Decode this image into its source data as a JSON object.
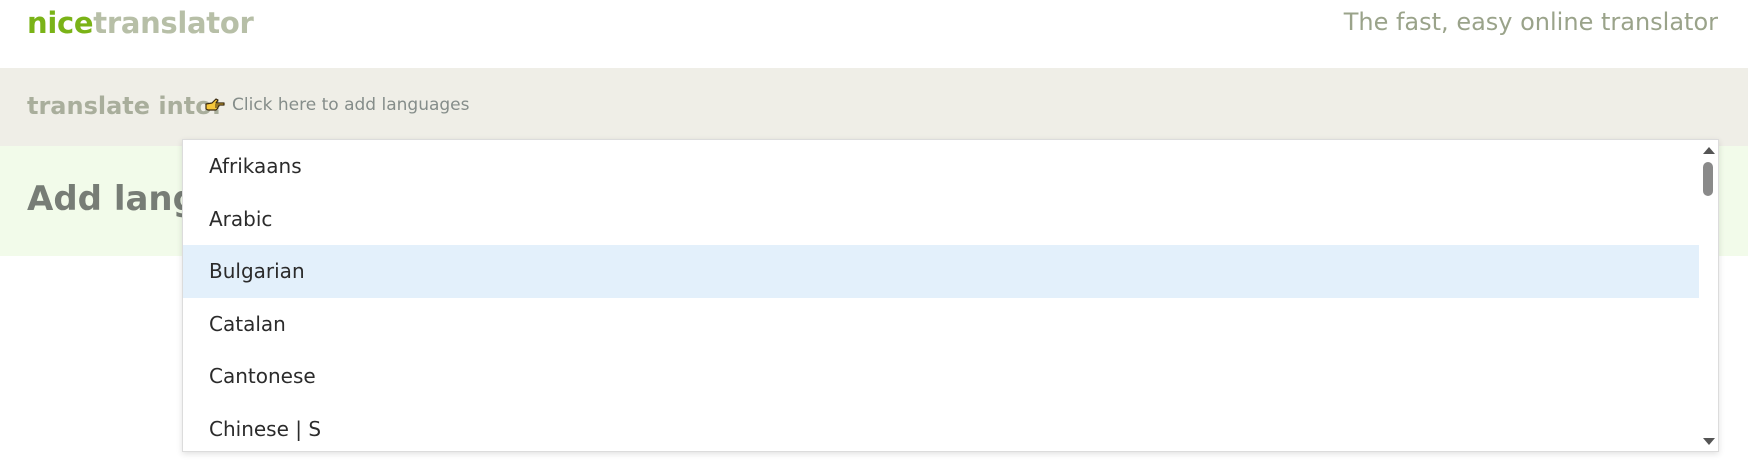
{
  "header": {
    "logo": {
      "part1": "nice",
      "part2": "translator"
    },
    "tagline": "The fast, easy online translator"
  },
  "translate_bar": {
    "label": "translate into:",
    "add_languages_link": "Click here to add languages",
    "icon": "pointing-hand-icon"
  },
  "main": {
    "heading_partial": "Add langu"
  },
  "dropdown": {
    "items": [
      {
        "label": "Afrikaans",
        "highlighted": false
      },
      {
        "label": "Arabic",
        "highlighted": false
      },
      {
        "label": "Bulgarian",
        "highlighted": true
      },
      {
        "label": "Catalan",
        "highlighted": false
      },
      {
        "label": "Cantonese",
        "highlighted": false
      },
      {
        "label": "Chinese | S",
        "highlighted": false
      }
    ]
  },
  "colors": {
    "brand_green": "#7ab317",
    "logo_gray": "#b7bfa7",
    "bar_background": "#efeee7",
    "band_background": "#f2fbea",
    "highlight": "#e3f0fb"
  }
}
